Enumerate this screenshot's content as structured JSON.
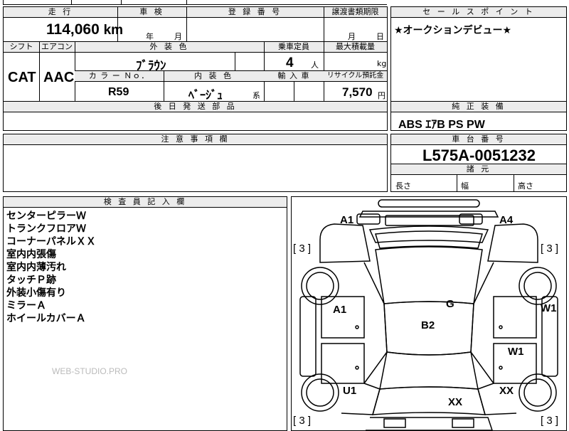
{
  "headers": {
    "mileage": "走 行",
    "inspection": "車 検",
    "reg_number": "登 録 番 号",
    "transfer_deadline": "譲渡書類期限",
    "selling_points": "セ ー ル ス ポ イ ン ト",
    "shift": "シフト",
    "aircon": "エアコン",
    "exterior_color": "外 装 色",
    "capacity": "乗車定員",
    "max_load": "最大積載量",
    "color_no": "カ ラ ー Ｎｏ．",
    "interior_color": "内 装 色",
    "import": "輸 入 車",
    "recycle": "リサイクル預託金",
    "later_parts": "後 日 発 送 部 品",
    "standard_equipment": "純 正 装 備",
    "notes": "注 意 事 項 欄",
    "chassis_number": "車 台 番 号",
    "specs": "諸 元",
    "inspector": "検 査 員 記 入 欄"
  },
  "values": {
    "mileage": "114,060",
    "mileage_unit": "km",
    "inspection_year": "年",
    "inspection_month": "月",
    "transfer_month": "月",
    "transfer_day": "日",
    "selling_point": "★オークションデビュー★",
    "shift": "CAT",
    "aircon": "AAC",
    "exterior_color": "ﾌﾞﾗｳﾝ",
    "capacity": "4",
    "capacity_unit": "人",
    "load_unit": "kg",
    "color_no": "R59",
    "interior_color": "ﾍﾞｰｼﾞｭ",
    "interior_suffix": "系",
    "recycle": "7,570",
    "recycle_unit": "円",
    "equipment": "ABS ｴｱB PS PW",
    "chassis_number": "L575A-0051232",
    "length_label": "長さ",
    "width_label": "幅",
    "height_label": "高さ"
  },
  "inspector_notes": [
    "センターピラーＷ",
    "トランクフロアＷ",
    "コーナーパネルＸＸ",
    "室内内張傷",
    "室内内薄汚れ",
    "タッチＰ跡",
    "外装小傷有り",
    "ミラーＡ",
    "ホイールカバーＡ"
  ],
  "watermark": "WEB-STUDIO.PRO",
  "diagram": {
    "tire_tl": "[ 3 ]",
    "tire_tr": "[ 3 ]",
    "tire_bl": "[ 3 ]",
    "tire_br": "[ 3 ]",
    "a1_top": "A1",
    "a4_top": "A4",
    "a1_door": "A1",
    "g": "G",
    "w1_right": "W1",
    "b2": "B2",
    "w1_door": "W1",
    "u1": "U1",
    "xx_right": "XX",
    "xx_center": "XX"
  }
}
